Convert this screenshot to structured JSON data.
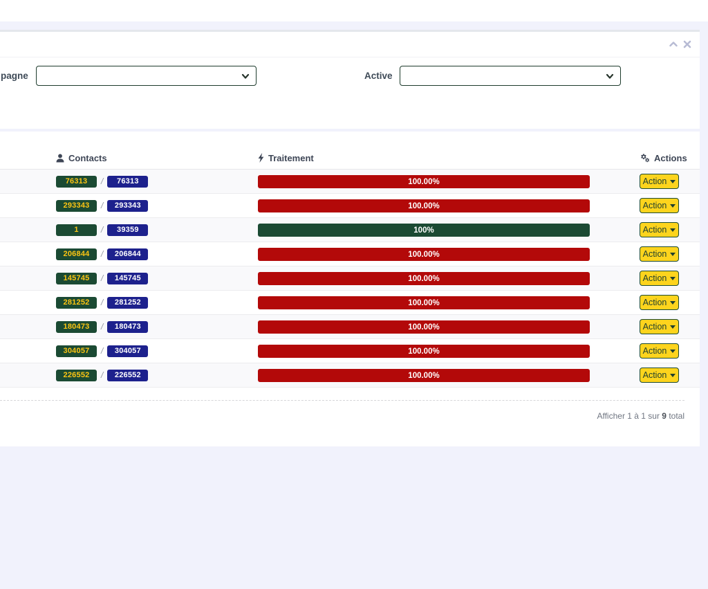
{
  "colors": {
    "page_bg": "#f1f2fc",
    "badge_done_bg": "#1b4a33",
    "badge_done_text": "#fdc513",
    "badge_total_bg": "#1d218d",
    "progress_red": "#b30909",
    "progress_green": "#1b4a33",
    "action_button_bg": "#fdd41d",
    "action_button_border": "#1b4a33",
    "panel_tools_icon": "#b7bbd4"
  },
  "filters": {
    "campagne_label": "pagne",
    "active_label": "Active",
    "campagne_select_value": "",
    "active_select_value": ""
  },
  "table": {
    "columns": [
      {
        "label": "Contacts",
        "icon": "user-icon"
      },
      {
        "label": "Traitement",
        "icon": "bolt-icon"
      },
      {
        "label": "Actions",
        "icon": "gears-icon"
      }
    ],
    "action_label": "Action",
    "separator": "/",
    "rows": [
      {
        "contacts_done": "76313",
        "contacts_total": "76313",
        "progress_label": "100.00%",
        "progress_color": "red"
      },
      {
        "contacts_done": "293343",
        "contacts_total": "293343",
        "progress_label": "100.00%",
        "progress_color": "red"
      },
      {
        "contacts_done": "1",
        "contacts_total": "39359",
        "progress_label": "100%",
        "progress_color": "green"
      },
      {
        "contacts_done": "206844",
        "contacts_total": "206844",
        "progress_label": "100.00%",
        "progress_color": "red"
      },
      {
        "contacts_done": "145745",
        "contacts_total": "145745",
        "progress_label": "100.00%",
        "progress_color": "red"
      },
      {
        "contacts_done": "281252",
        "contacts_total": "281252",
        "progress_label": "100.00%",
        "progress_color": "red"
      },
      {
        "contacts_done": "180473",
        "contacts_total": "180473",
        "progress_label": "100.00%",
        "progress_color": "red"
      },
      {
        "contacts_done": "304057",
        "contacts_total": "304057",
        "progress_label": "100.00%",
        "progress_color": "red"
      },
      {
        "contacts_done": "226552",
        "contacts_total": "226552",
        "progress_label": "100.00%",
        "progress_color": "red"
      }
    ],
    "footer": {
      "prefix": "Afficher 1 à 1 sur ",
      "total": "9",
      "suffix": " total"
    }
  }
}
